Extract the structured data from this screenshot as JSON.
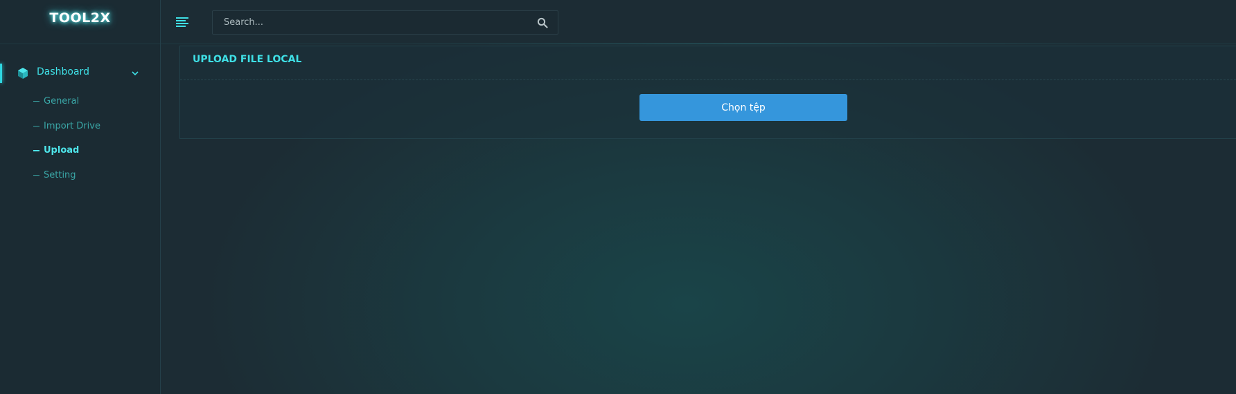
{
  "brand": {
    "name": "TOOL2X"
  },
  "sidebar": {
    "group": {
      "label": "Dashboard",
      "icon": "cube-icon",
      "expanded": true
    },
    "items": [
      {
        "label": "General",
        "active": false
      },
      {
        "label": "Import Drive",
        "active": false
      },
      {
        "label": "Upload",
        "active": true
      },
      {
        "label": "Setting",
        "active": false
      }
    ]
  },
  "header": {
    "menu_icon": "hamburger-icon",
    "search": {
      "placeholder": "Search...",
      "value": "",
      "icon": "search-icon"
    }
  },
  "main": {
    "card_title": "UPLOAD FILE LOCAL",
    "choose_file_label": "Chọn tệp"
  },
  "colors": {
    "accent": "#3fe0e6",
    "button": "#3596dc",
    "sidebar_bg": "#1b2b33",
    "page_bg": "#1c2c34"
  }
}
